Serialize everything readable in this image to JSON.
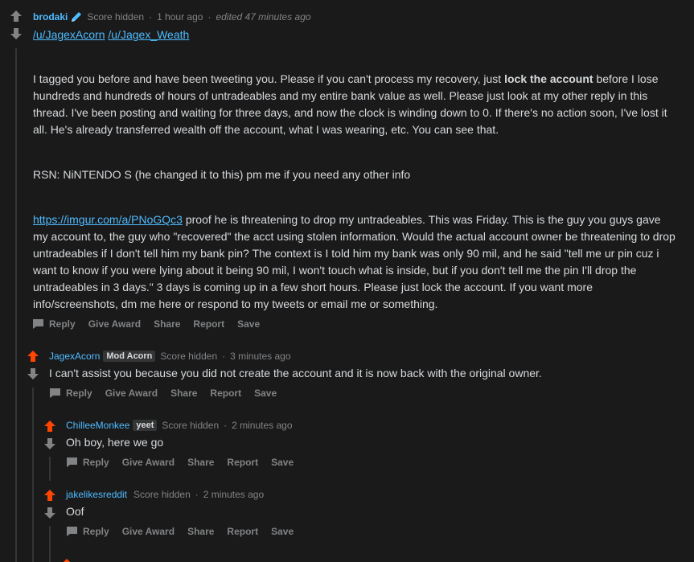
{
  "comments": [
    {
      "author": "brodaki",
      "score": "Score hidden",
      "time": "1 hour ago",
      "edited": "edited 47 minutes ago",
      "mentions": [
        "/u/JagexAcorn",
        "/u/Jagex_Weath"
      ],
      "p1_before": "I tagged you before and have been tweeting you. Please if you can't process my recovery, just ",
      "p1_bold": "lock the account",
      "p1_after": " before I lose hundreds and hundreds of hours of untradeables and my entire bank value as well. Please just look at my other reply in this thread. I've been posting and waiting for three days, and now the clock is winding down to 0. If there's no action soon, I've lost it all. He's already transferred wealth off the account, what I was wearing, etc. You can see that.",
      "p2": "RSN: NiNTENDO S (he changed it to this) pm me if you need any other info",
      "p3_link": "https://imgur.com/a/PNoGQc3",
      "p3_text": " proof he is threatening to drop my untradeables. This was Friday. This is the guy you guys gave my account to, the guy who \"recovered\" the acct using stolen information. Would the actual account owner be threatening to drop untradeables if I don't tell him my bank pin? The context is I told him my bank was only 90 mil, and he said \"tell me ur pin cuz i want to know if you were lying about it being 90 mil, I won't touch what is inside, but if you don't tell me the pin I'll drop the untradeables in 3 days.\" 3 days is coming up in a few short hours. Please just lock the account. If you want more info/screenshots, dm me here or respond to my tweets or email me or something."
    },
    {
      "author": "JagexAcorn",
      "flair": "Mod Acorn",
      "score": "Score hidden",
      "time": "3 minutes ago",
      "body": "I can't assist you because you did not create the account and it is now back with the original owner."
    },
    {
      "author": "ChilleeMonkee",
      "flair": "yeet",
      "score": "Score hidden",
      "time": "2 minutes ago",
      "body": "Oh boy, here we go"
    },
    {
      "author": "jakelikesreddit",
      "score": "Score hidden",
      "time": "2 minutes ago",
      "body": "Oof"
    }
  ],
  "actions": {
    "reply": "Reply",
    "give_award": "Give Award",
    "share": "Share",
    "report": "Report",
    "save": "Save"
  },
  "colors": {
    "background": "#1a1a1b",
    "text": "#d7dadc",
    "muted": "#818384",
    "link": "#4fbcff",
    "upvoted": "#ff4500",
    "flair_bg": "#343536"
  },
  "icons": [
    "upvote-icon",
    "downvote-icon",
    "comment-bubble-icon",
    "pencil-icon"
  ]
}
